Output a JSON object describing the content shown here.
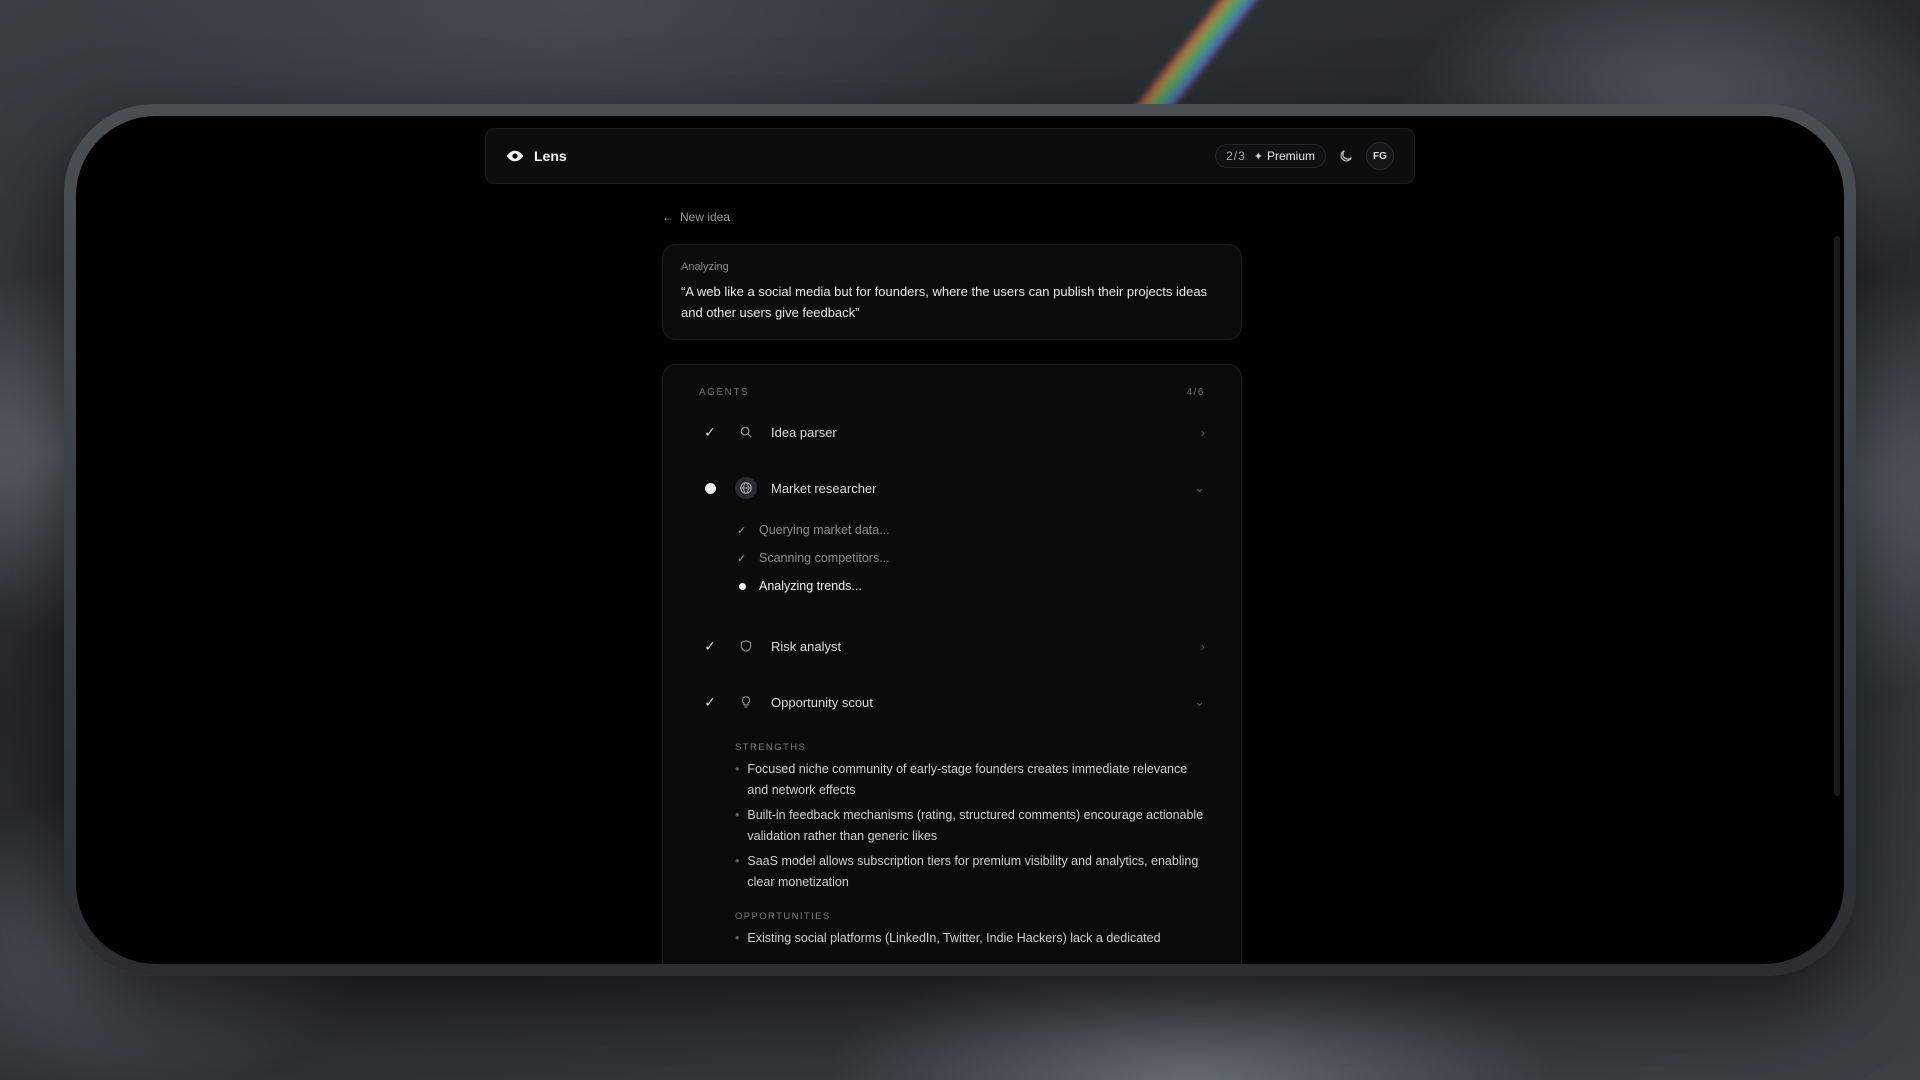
{
  "app": {
    "name": "Lens"
  },
  "header": {
    "usage": "2/3",
    "premium_label": "Premium",
    "avatar_initials": "FG"
  },
  "nav": {
    "back_label": "New idea"
  },
  "idea": {
    "label": "Analyzing",
    "text": "“A web like a social media but for founders, where the users can publish their projects ideas and other users give feedback”"
  },
  "agents": {
    "title": "AGENTS",
    "progress": "4/6",
    "items": [
      {
        "name": "Idea parser",
        "status": "done",
        "icon": "search-icon"
      },
      {
        "name": "Market researcher",
        "status": "running",
        "icon": "globe-icon",
        "steps": [
          {
            "label": "Querying market data...",
            "status": "done"
          },
          {
            "label": "Scanning competitors...",
            "status": "done"
          },
          {
            "label": "Analyzing trends...",
            "status": "running"
          }
        ]
      },
      {
        "name": "Risk analyst",
        "status": "done",
        "icon": "shield-icon"
      },
      {
        "name": "Opportunity scout",
        "status": "done",
        "icon": "lightbulb-icon"
      }
    ]
  },
  "result": {
    "strengths_title": "STRENGTHS",
    "strengths": [
      "Focused niche community of early-stage founders creates immediate relevance and network effects",
      "Built-in feedback mechanisms (rating, structured comments) encourage actionable validation rather than generic likes",
      "SaaS model allows subscription tiers for premium visibility and analytics, enabling clear monetization"
    ],
    "opportunities_title": "OPPORTUNITIES",
    "opportunities": [
      "Existing social platforms (LinkedIn, Twitter, Indie Hackers) lack a dedicated"
    ]
  }
}
